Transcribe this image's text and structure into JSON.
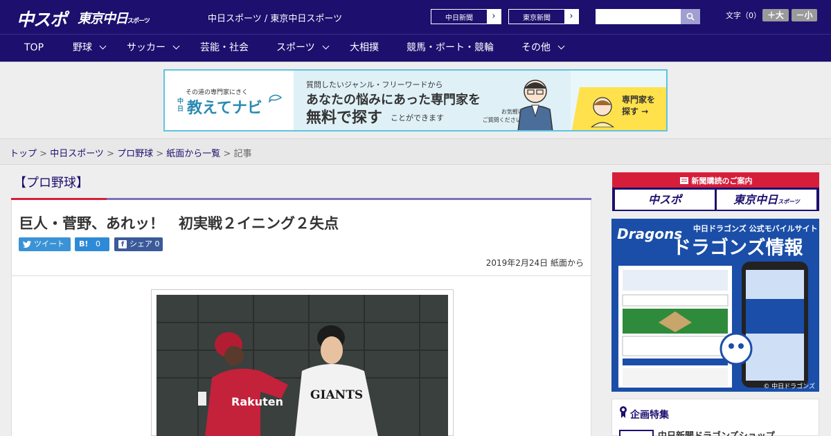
{
  "header": {
    "logo_chuspo": "中スポ",
    "logo_tokyo": "東京中日",
    "logo_tokyo_sub": "スポーツ",
    "site_links": "中日スポーツ / 東京中日スポーツ",
    "paper_buttons": [
      {
        "label": "中日新聞"
      },
      {
        "label": "東京新聞"
      }
    ],
    "search_placeholder": "",
    "fontsize_label": "文字（0）",
    "fontsize_up": "＋大",
    "fontsize_down": "－小"
  },
  "nav": {
    "items": [
      {
        "label": "TOP",
        "dropdown": false
      },
      {
        "label": "野球",
        "dropdown": true
      },
      {
        "label": "サッカー",
        "dropdown": true
      },
      {
        "label": "芸能・社会",
        "dropdown": false
      },
      {
        "label": "スポーツ",
        "dropdown": true
      },
      {
        "label": "大相撲",
        "dropdown": false
      },
      {
        "label": "競馬・ボート・競輪",
        "dropdown": false
      },
      {
        "label": "その他",
        "dropdown": true
      }
    ]
  },
  "banner": {
    "tagline": "その道の専門家にきく",
    "brand_kicker": "中日",
    "brand": "教えてナビ",
    "line1": "質問したいジャンル・フリーワードから",
    "line2": "あなたの悩みにあった専門家を",
    "line3": "無料で探す",
    "line3b": "ことができます",
    "line4a": "お気軽に",
    "line4b": "ご質問ください!",
    "cta_line1": "専門家を",
    "cta_line2": "探す →"
  },
  "breadcrumb": {
    "items": [
      "トップ",
      "中日スポーツ",
      "プロ野球",
      "紙面から一覧"
    ],
    "current": "記事",
    "separator": " > "
  },
  "category": "【プロ野球】",
  "article": {
    "title": "巨人・菅野、あれッ！　初実戦２イニング２失点",
    "share": {
      "twitter": "ツイート",
      "hatena_icon": "B!",
      "hatena_count": "0",
      "facebook": "シェア",
      "facebook_count": "0"
    },
    "date": "2019年2月24日",
    "source": "紙面から"
  },
  "sidebar": {
    "subscribe_heading": "新聞購読のご案内",
    "subscribe_buttons": [
      "中スポ",
      "東京中日"
    ],
    "subscribe_sub": "スポーツ",
    "dragons_logo": "Dragons",
    "dragons_sub": "中日ドラゴンズ 公式モバイルサイト",
    "dragons_big": "ドラゴンズ情報",
    "dragons_copy": "© 中日ドラゴンズ",
    "feature_title": "企画特集",
    "feature_item": "中日新聞ドラゴンズショップ"
  },
  "colors": {
    "brand_navy": "#1c0f6e",
    "accent_red": "#d61e3a",
    "accent_purple": "#7b72b8",
    "banner_border": "#5fc3e0",
    "twitter": "#3a93d6",
    "facebook": "#3b5a9a"
  }
}
